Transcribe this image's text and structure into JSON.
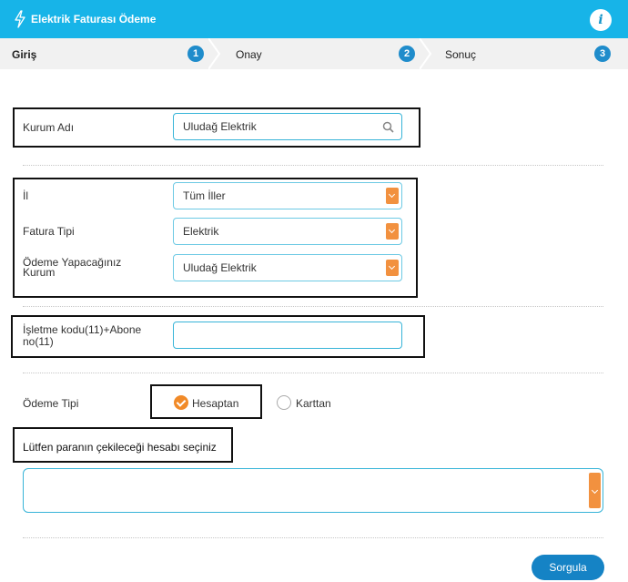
{
  "header": {
    "title": "Elektrik Faturası Ödeme",
    "bolt_icon": "lightning-bolt-icon",
    "info_icon": "info-icon",
    "info_glyph": "i",
    "background": "#17b4e8"
  },
  "steps": [
    {
      "label": "Giriş",
      "number": "1"
    },
    {
      "label": "Onay",
      "number": "2"
    },
    {
      "label": "Sonuç",
      "number": "3"
    }
  ],
  "form": {
    "kurum": {
      "label": "Kurum Adı",
      "value": "Uludağ Elektrik"
    },
    "il": {
      "label": "İl",
      "value": "Tüm İller"
    },
    "fatura_tipi": {
      "label": "Fatura Tipi",
      "value": "Elektrik"
    },
    "odeme_kurum": {
      "label_line1": "Ödeme Yapacağınız",
      "label_line2": "Kurum",
      "value": "Uludağ Elektrik"
    },
    "abone": {
      "label_line1": "İşletme kodu(11)+Abone",
      "label_line2": "no(11)",
      "value": ""
    },
    "odeme_tipi": {
      "label": "Ödeme Tipi",
      "option_hesap": "Hesaptan",
      "option_kart": "Karttan",
      "selected": "Hesaptan"
    },
    "hesap": {
      "label": "Lütfen paranın çekileceği hesabı seçiniz",
      "value": ""
    }
  },
  "actions": {
    "submit_label": "Sorgula"
  },
  "colors": {
    "accent": "#17b4e8",
    "dropdown": "#f2913f",
    "radio_selected": "#f18a28",
    "button": "#1583c5"
  }
}
